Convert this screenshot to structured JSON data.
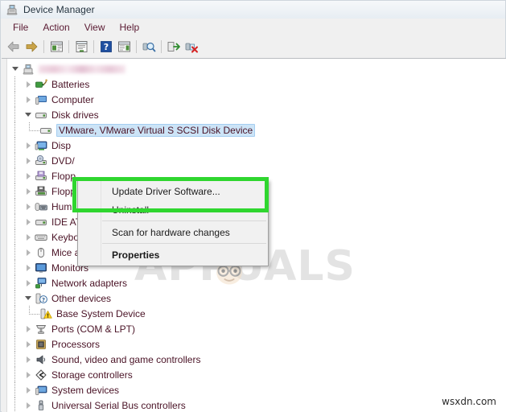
{
  "window": {
    "title": "Device Manager",
    "icon": "device-manager-icon"
  },
  "menubar": {
    "items": [
      {
        "label": "File",
        "name": "menu-file"
      },
      {
        "label": "Action",
        "name": "menu-action"
      },
      {
        "label": "View",
        "name": "menu-view"
      },
      {
        "label": "Help",
        "name": "menu-help"
      }
    ]
  },
  "toolbar": {
    "buttons": [
      {
        "name": "back-button",
        "icon": "left-arrow-icon",
        "tooltip": "Back"
      },
      {
        "name": "forward-button",
        "icon": "right-arrow-icon",
        "tooltip": "Forward"
      },
      {
        "name": "show-hide-console-tree-button",
        "icon": "console-tree-icon",
        "tooltip": "Show/Hide Console Tree"
      },
      {
        "name": "properties-button",
        "icon": "properties-window-icon",
        "tooltip": "Properties"
      },
      {
        "name": "help-button",
        "icon": "help-question-icon",
        "tooltip": "Help"
      },
      {
        "name": "show-hide-action-pane-button",
        "icon": "action-pane-icon",
        "tooltip": "Show/Hide Action Pane"
      },
      {
        "name": "scan-for-hardware-changes-button",
        "icon": "scan-hardware-icon",
        "tooltip": "Scan for hardware changes"
      },
      {
        "name": "update-driver-button",
        "icon": "update-driver-icon",
        "tooltip": "Update Driver Software"
      },
      {
        "name": "uninstall-device-button",
        "icon": "uninstall-device-icon",
        "tooltip": "Uninstall"
      }
    ]
  },
  "tree": {
    "root": {
      "label": "",
      "redacted": true,
      "icon": "computer-root-icon",
      "expanded": true
    },
    "nodes": [
      {
        "label": "Batteries",
        "icon": "battery-icon",
        "expanded": false,
        "indent": 1
      },
      {
        "label": "Computer",
        "icon": "computer-icon",
        "expanded": false,
        "indent": 1
      },
      {
        "label": "Disk drives",
        "icon": "disk-drive-icon",
        "expanded": true,
        "indent": 1
      },
      {
        "label": "VMware, VMware Virtual S SCSI Disk Device",
        "icon": "disk-icon",
        "expanded": null,
        "indent": 2,
        "selected": true
      },
      {
        "label": "Display adapters",
        "icon": "display-adapter-icon",
        "expanded": false,
        "indent": 1,
        "truncated": "Disp"
      },
      {
        "label": "DVD/CD-ROM drives",
        "icon": "dvd-drive-icon",
        "expanded": false,
        "indent": 1,
        "truncated": "DVD/"
      },
      {
        "label": "Floppy disk drives",
        "icon": "floppy-drive-icon",
        "expanded": false,
        "indent": 1,
        "truncated": "Flopp"
      },
      {
        "label": "Floppy drive controllers",
        "icon": "floppy-controller-icon",
        "expanded": false,
        "indent": 1,
        "truncated": "Flopp"
      },
      {
        "label": "Human Interface Devices",
        "icon": "hid-icon",
        "expanded": false,
        "indent": 1,
        "truncated": "Hum"
      },
      {
        "label": "IDE ATA/ATAPI controllers",
        "icon": "ide-controller-icon",
        "expanded": false,
        "indent": 1
      },
      {
        "label": "Keyboards",
        "icon": "keyboard-icon",
        "expanded": false,
        "indent": 1
      },
      {
        "label": "Mice and other pointing devices",
        "icon": "mouse-icon",
        "expanded": false,
        "indent": 1
      },
      {
        "label": "Monitors",
        "icon": "monitor-icon",
        "expanded": false,
        "indent": 1
      },
      {
        "label": "Network adapters",
        "icon": "network-adapter-icon",
        "expanded": false,
        "indent": 1
      },
      {
        "label": "Other devices",
        "icon": "other-devices-icon",
        "expanded": true,
        "indent": 1
      },
      {
        "label": "Base System Device",
        "icon": "warning-device-icon",
        "expanded": null,
        "indent": 2
      },
      {
        "label": "Ports (COM & LPT)",
        "icon": "ports-icon",
        "expanded": false,
        "indent": 1
      },
      {
        "label": "Processors",
        "icon": "processor-icon",
        "expanded": false,
        "indent": 1
      },
      {
        "label": "Sound, video and game controllers",
        "icon": "sound-icon",
        "expanded": false,
        "indent": 1
      },
      {
        "label": "Storage controllers",
        "icon": "storage-controller-icon",
        "expanded": false,
        "indent": 1
      },
      {
        "label": "System devices",
        "icon": "system-device-icon",
        "expanded": false,
        "indent": 1
      },
      {
        "label": "Universal Serial Bus controllers",
        "icon": "usb-icon",
        "expanded": false,
        "indent": 1
      }
    ]
  },
  "context_menu": {
    "items": [
      {
        "label": "Update Driver Software...",
        "name": "ctx-update-driver-software",
        "bold": false
      },
      {
        "label": "Uninstall",
        "name": "ctx-uninstall",
        "bold": false
      },
      {
        "separator": true
      },
      {
        "label": "Scan for hardware changes",
        "name": "ctx-scan-for-hardware-changes",
        "bold": false
      },
      {
        "separator": true
      },
      {
        "label": "Properties",
        "name": "ctx-properties",
        "bold": true
      }
    ]
  },
  "annotation": {
    "highlight_color": "#2fd62f",
    "highlight_target": "Update Driver Software..."
  },
  "watermarks": {
    "center": "APPUALS",
    "bottom_right": "wsxdn.com"
  }
}
